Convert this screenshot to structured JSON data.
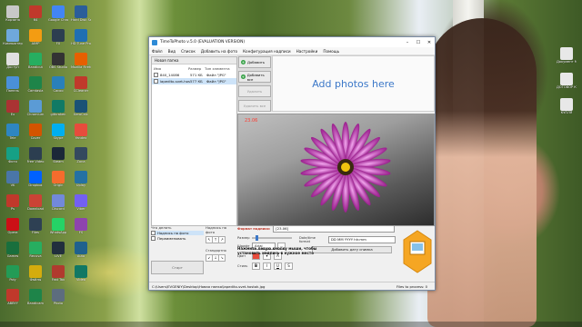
{
  "desktop_icons": [
    {
      "label": "Корзина",
      "color": "#c8c8c8",
      "col": 0,
      "row": 0
    },
    {
      "label": "64",
      "color": "#c0392b",
      "col": 1,
      "row": 0
    },
    {
      "label": "Google Chrome",
      "color": "#4285f4",
      "col": 2,
      "row": 0
    },
    {
      "label": "Hard Disk Sentinel",
      "color": "#2b5e9a",
      "col": 3,
      "row": 0
    },
    {
      "label": "Компьютер",
      "color": "#6fa8dc",
      "col": 0,
      "row": 1
    },
    {
      "label": "AIMP",
      "color": "#f39c12",
      "col": 1,
      "row": 1
    },
    {
      "label": "FX",
      "color": "#2c3e50",
      "col": 2,
      "row": 1
    },
    {
      "label": "HD Tune Pro",
      "color": "#1f6fb2",
      "col": 3,
      "row": 1
    },
    {
      "label": "Доступ",
      "color": "#e0e0e0",
      "col": 0,
      "row": 2
    },
    {
      "label": "Bandicut",
      "color": "#27ae60",
      "col": 1,
      "row": 2
    },
    {
      "label": "OBS Studio",
      "color": "#333333",
      "col": 2,
      "row": 2
    },
    {
      "label": "Mozilla Firefox",
      "color": "#e66000",
      "col": 3,
      "row": 2
    },
    {
      "label": "Панель",
      "color": "#4a90d9",
      "col": 0,
      "row": 3
    },
    {
      "label": "Camtasia",
      "color": "#1e8449",
      "col": 1,
      "row": 3
    },
    {
      "label": "Cacoo",
      "color": "#2980b9",
      "col": 2,
      "row": 3
    },
    {
      "label": "CCleaner",
      "color": "#c0392b",
      "col": 3,
      "row": 3
    },
    {
      "label": "Ex",
      "color": "#aa3333",
      "col": 0,
      "row": 4
    },
    {
      "label": "Chromium",
      "color": "#5b9bd5",
      "col": 1,
      "row": 4
    },
    {
      "label": "gitkraken",
      "color": "#117a65",
      "col": 2,
      "row": 4
    },
    {
      "label": "KeroCalc",
      "color": "#1a5276",
      "col": 3,
      "row": 4
    },
    {
      "label": "Tele",
      "color": "#2e86c1",
      "col": 0,
      "row": 5
    },
    {
      "label": "Cover",
      "color": "#d35400",
      "col": 1,
      "row": 5
    },
    {
      "label": "Skype",
      "color": "#00aff0",
      "col": 2,
      "row": 5
    },
    {
      "label": "Yandex",
      "color": "#e74c3c",
      "col": 3,
      "row": 5
    },
    {
      "label": "Фото",
      "color": "#16a085",
      "col": 0,
      "row": 6
    },
    {
      "label": "Free Video",
      "color": "#2c3e50",
      "col": 1,
      "row": 6
    },
    {
      "label": "Steam",
      "color": "#1b2838",
      "col": 2,
      "row": 6
    },
    {
      "label": "Zona",
      "color": "#34495e",
      "col": 3,
      "row": 6
    },
    {
      "label": "VK",
      "color": "#4a76a8",
      "col": 0,
      "row": 7
    },
    {
      "label": "Dropbox",
      "color": "#0061ff",
      "col": 1,
      "row": 7
    },
    {
      "label": "Origin",
      "color": "#f56c2d",
      "col": 2,
      "row": 7
    },
    {
      "label": "Uplay",
      "color": "#2471a3",
      "col": 3,
      "row": 7
    },
    {
      "label": "Ps",
      "color": "#c0392b",
      "col": 0,
      "row": 8
    },
    {
      "label": "Download",
      "color": "#cb4335",
      "col": 1,
      "row": 8
    },
    {
      "label": "Discord",
      "color": "#7289da",
      "col": 2,
      "row": 8
    },
    {
      "label": "Viber",
      "color": "#7360f2",
      "col": 3,
      "row": 8
    },
    {
      "label": "Opera",
      "color": "#cc0f16",
      "col": 0,
      "row": 9
    },
    {
      "label": "Files",
      "color": "#2e4053",
      "col": 1,
      "row": 9
    },
    {
      "label": "WhatsApp",
      "color": "#25d366",
      "col": 2,
      "row": 9
    },
    {
      "label": "FS",
      "color": "#8e44ad",
      "col": 3,
      "row": 9
    },
    {
      "label": "Games",
      "color": "#196f3d",
      "col": 0,
      "row": 10
    },
    {
      "label": "Recuva",
      "color": "#27ae60",
      "col": 1,
      "row": 10
    },
    {
      "label": "LIVE",
      "color": "#212f3d",
      "col": 2,
      "row": 10
    },
    {
      "label": "Auto",
      "color": "#1f618d",
      "col": 3,
      "row": 10
    },
    {
      "label": "Poly",
      "color": "#239b56",
      "col": 0,
      "row": 11
    },
    {
      "label": "Файлы",
      "color": "#d4ac0d",
      "col": 1,
      "row": 11
    },
    {
      "label": "Fast Tax",
      "color": "#b03a2e",
      "col": 2,
      "row": 11
    },
    {
      "label": "Video",
      "color": "#117864",
      "col": 3,
      "row": 11
    },
    {
      "label": "ABBYY",
      "color": "#c0392b",
      "col": 0,
      "row": 12
    },
    {
      "label": "Bandicam",
      "color": "#1e8449",
      "col": 1,
      "row": 12
    },
    {
      "label": "Photo",
      "color": "#5d6d7e",
      "col": 2,
      "row": 12
    }
  ],
  "right_icons": [
    {
      "label": "Документ Microsoft",
      "color": "#e8e8e8"
    },
    {
      "label": "ДОГОВОР КУПЛИ",
      "color": "#e8e8e8"
    },
    {
      "label": "КУПЛЯ",
      "color": "#e8e8e8"
    }
  ],
  "window": {
    "title": "TimeToPhoto v.5.0 (EVALUATION VERSION)",
    "menu": [
      "Файл",
      "Вид",
      "Список",
      "Добавить на фото",
      "Конфигурация надписи",
      "Настройки",
      "Помощь"
    ],
    "left_header": "Новая папка",
    "columns": [
      "Имя",
      "Размер",
      "Тип элемента"
    ],
    "files": [
      {
        "name": "840_14086",
        "size": "571 КБ",
        "type": "Файл \"JPG\"",
        "selected": false
      },
      {
        "name": "lapedito-svet-hostok",
        "size": "577 КБ",
        "type": "Файл \"JPG\"",
        "selected": true
      }
    ],
    "buttons": {
      "add": "Добавить",
      "add_all": "Добавить все",
      "remove": "Удалить",
      "remove_all": "Удалить все"
    },
    "add_photos": "Add photos here",
    "preview_timestamp": "23.06",
    "what_to_do_label": "Что делать",
    "options": [
      {
        "label": "Надпись на фото",
        "selected": true
      },
      {
        "label": "Переименовать",
        "selected": false
      }
    ],
    "start_button": "Старт",
    "position_label": "Надпись на фото",
    "standard_label": "Стандартно",
    "format_label": "Формат надписи:",
    "format_value": "[23.06]",
    "size_label": "Размер",
    "font_label": "Шрифт",
    "font_value": "Arial",
    "color_label": "Цвет",
    "style_label": "Стиль",
    "date_format_label": "Date/time format",
    "date_format_value": "DD MM YYYY hh:mm",
    "add_date_button": "Добавить дату снимка",
    "hint": "Нажмите левую кнопку мыши, чтобы установить надпись в нужное место",
    "status_left": "C:\\Users\\EVGENIY\\Desktop\\Новая папка\\lapedito-svet-hostok.jpg",
    "status_right": "Files to process: 0"
  }
}
